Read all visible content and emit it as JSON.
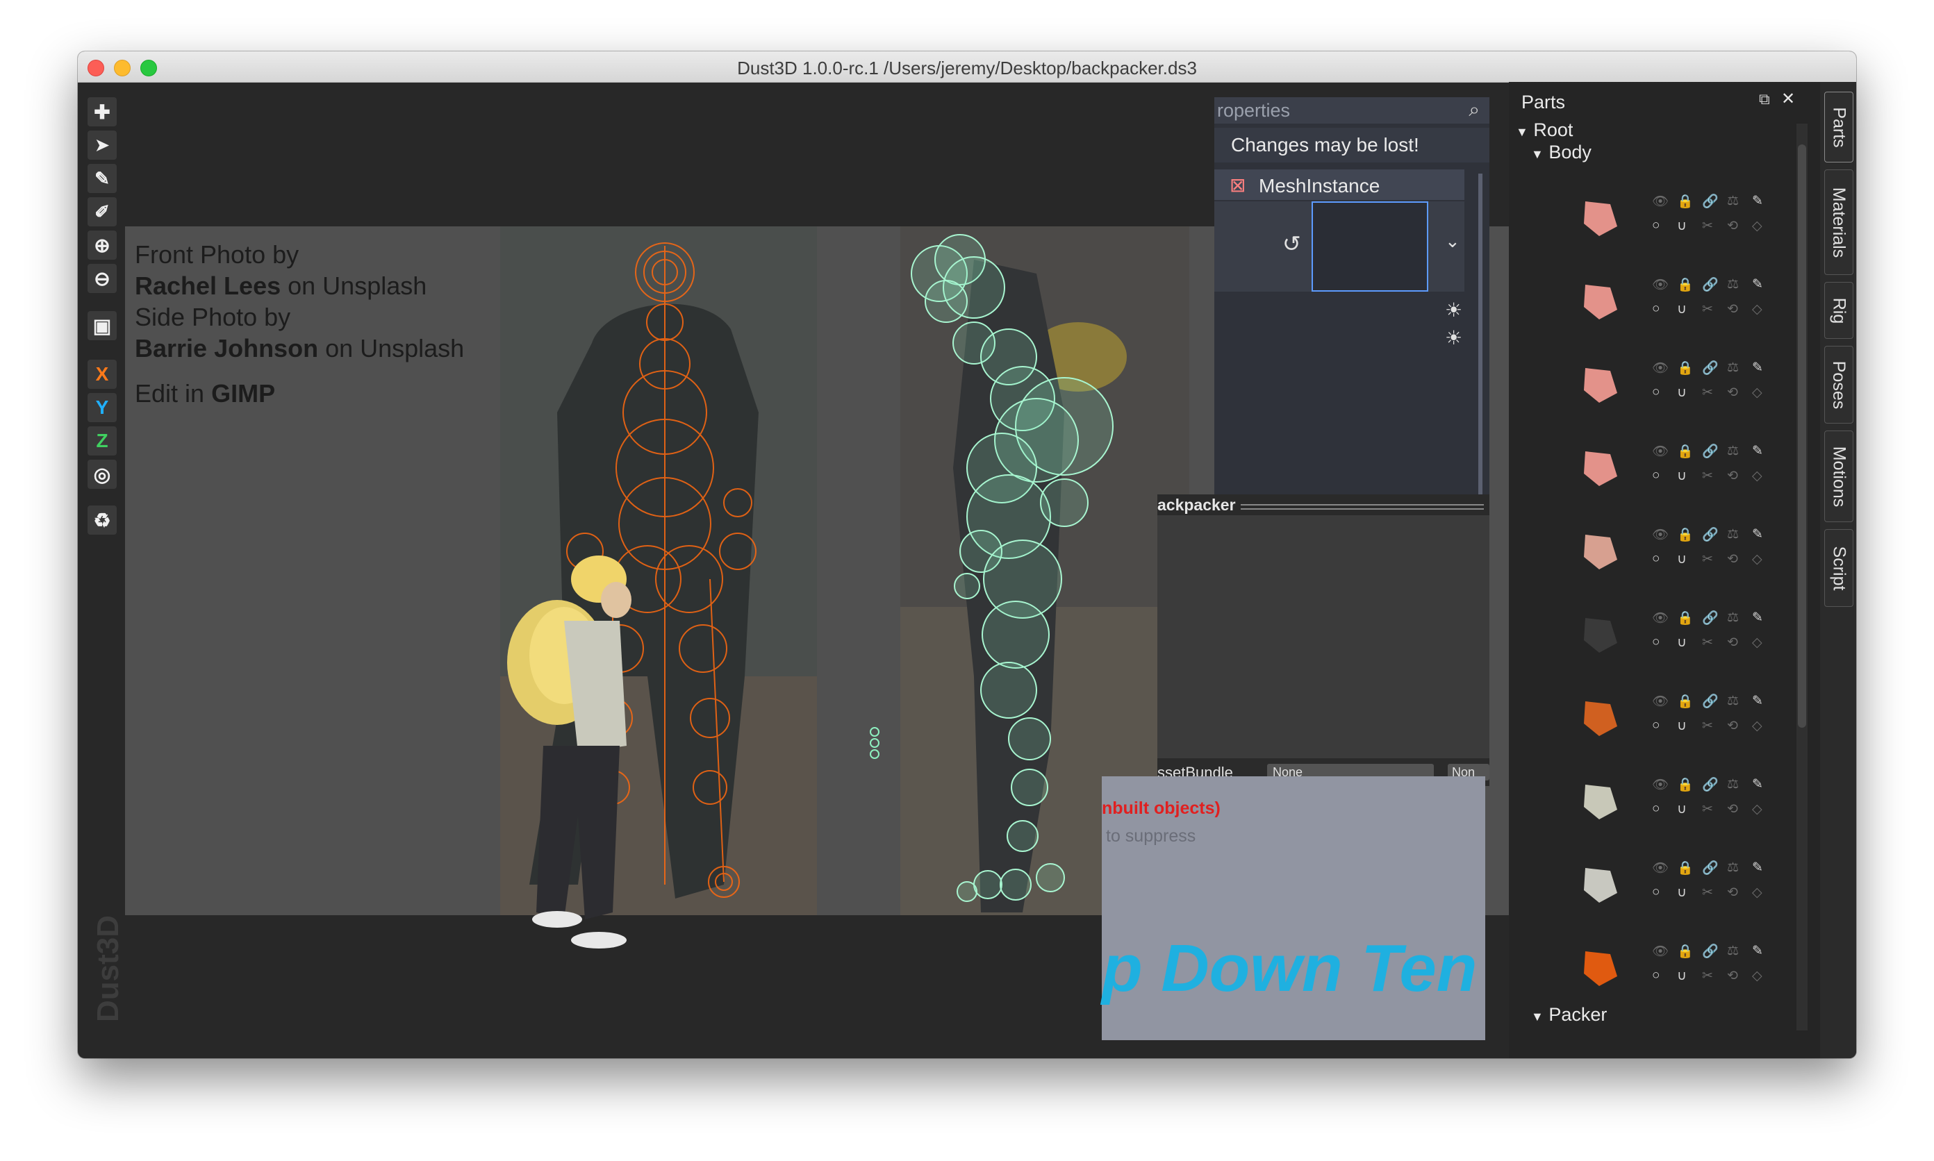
{
  "window": {
    "title": "Dust3D 1.0.0-rc.1 /Users/jeremy/Desktop/backpacker.ds3"
  },
  "toolbar": {
    "items": [
      {
        "name": "add-tool",
        "glyph": "✚"
      },
      {
        "name": "select-tool",
        "glyph": "➤"
      },
      {
        "name": "mark-tool",
        "glyph": "✎"
      },
      {
        "name": "paint-tool",
        "glyph": "✐"
      },
      {
        "name": "zoom-in-tool",
        "glyph": "⊕"
      },
      {
        "name": "zoom-out-tool",
        "glyph": "⊖"
      },
      {
        "name": "camera-tool",
        "glyph": "▣"
      },
      {
        "name": "x-axis-lock",
        "glyph": "X",
        "color": "#ff7a1a"
      },
      {
        "name": "y-axis-lock",
        "glyph": "Y",
        "color": "#20b0ff"
      },
      {
        "name": "z-axis-lock",
        "glyph": "Z",
        "color": "#40d060"
      },
      {
        "name": "radius-lock",
        "glyph": "◎"
      },
      {
        "name": "regenerate",
        "glyph": "♻"
      }
    ],
    "watermark": "Dust3D"
  },
  "credits": {
    "line1_prefix": "Front Photo by",
    "line2_name": "Rachel Lees",
    "line2_suffix": "on Unsplash",
    "line3_prefix": "Side Photo by",
    "line4_name": "Barrie Johnson",
    "line4_suffix": "on Unsplash",
    "line5_prefix": "Edit in",
    "line5_name": "GIMP"
  },
  "inspector": {
    "search_text": "roperties",
    "warning": "Changes may be lost!",
    "node_name": "MeshInstance"
  },
  "asset_window": {
    "title": "ackpacker",
    "bundle_label": "ssetBundle",
    "bundle_value": "None",
    "bundle_value2": "Non"
  },
  "game_window": {
    "error": "nbuilt objects)",
    "hint": "to suppress",
    "banner": "p Down Ten"
  },
  "parts_panel": {
    "header": "Parts",
    "root": "Root",
    "body": "Body",
    "packer": "Packer",
    "tabs": [
      "Parts",
      "Materials",
      "Rig",
      "Poses",
      "Motions",
      "Script"
    ],
    "rows": [
      {
        "color": "#e3928a"
      },
      {
        "color": "#e3928a"
      },
      {
        "color": "#e3928a"
      },
      {
        "color": "#e3928a"
      },
      {
        "color": "#d7a090"
      },
      {
        "color": "#3a3a3a"
      },
      {
        "color": "#d06020"
      },
      {
        "color": "#c8c8b8"
      },
      {
        "color": "#c8c8c0"
      },
      {
        "color": "#e05a10"
      }
    ]
  },
  "colors": {
    "accent_orange": "#ff6a10",
    "mesh_green": "#8ef0c0",
    "godot_dark": "#313542"
  }
}
